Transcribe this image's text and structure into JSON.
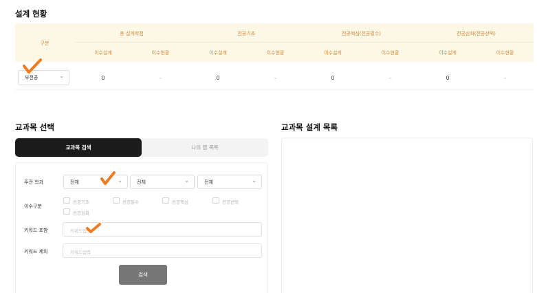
{
  "design_status": {
    "title": "설계 현황",
    "category_header": "구분",
    "groups": [
      {
        "label": "총 설계학점",
        "sub": [
          "이수설계",
          "이수현황"
        ],
        "values": [
          "0",
          "-"
        ]
      },
      {
        "label": "전공기초",
        "sub": [
          "이수설계",
          "이수현황"
        ],
        "values": [
          "0",
          "-"
        ]
      },
      {
        "label": "전공핵심(전공필수)",
        "sub": [
          "이수설계",
          "이수현황"
        ],
        "values": [
          "0",
          "-"
        ]
      },
      {
        "label": "전공심화(전공선택)",
        "sub": [
          "이수설계",
          "이수현황"
        ],
        "values": [
          "0",
          "-"
        ]
      }
    ],
    "major_select": "부전공"
  },
  "course_selection": {
    "title": "교과목 선택",
    "tabs": [
      "교과목 검색",
      "나의 찜 목록"
    ],
    "form": {
      "dept_label": "주관 학과",
      "selects": [
        "전체",
        "전체",
        "전체"
      ],
      "type_label": "이수구분",
      "checkboxes": [
        "전공기초",
        "전공필수",
        "전공핵심",
        "전공선택",
        "전공심화"
      ],
      "kw_include_label": "키워드 포함",
      "kw_include_placeholder": "키워드입력",
      "kw_exclude_label": "키워드 제외",
      "kw_exclude_placeholder": "키워드입력",
      "search_button": "검색"
    }
  },
  "course_design_list": {
    "title": "교과목 설계 목록"
  },
  "colors": {
    "accent_orange": "#f07b1f",
    "header_bg": "#fdf8e6",
    "header_text": "#d58a3a",
    "dark_tab": "#1c1c1c",
    "button": "#777777"
  },
  "icons": [
    "chevron-down-icon",
    "checkmark-annotation-icon"
  ]
}
